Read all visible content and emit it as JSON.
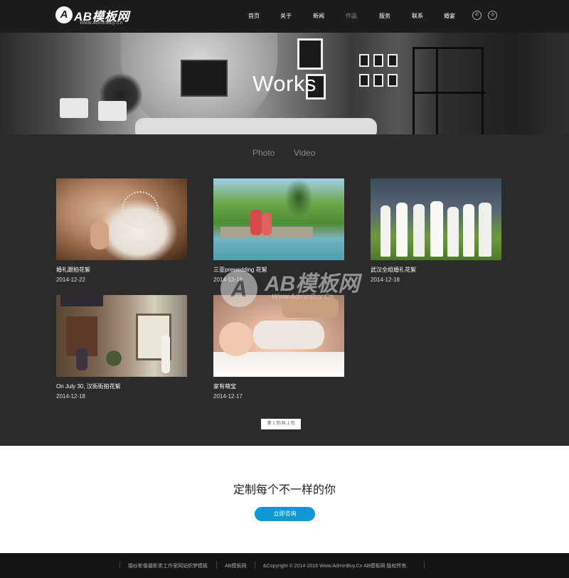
{
  "header": {
    "logo_mark": "A",
    "logo_text": "AB模板网",
    "logo_sub": "Www.AdminBuy.Cn",
    "nav": [
      "首页",
      "关于",
      "新闻",
      "作品",
      "服务",
      "联系",
      "婚宴"
    ],
    "active_nav": "作品",
    "icons": {
      "phone": "phone-icon",
      "wechat": "wechat-icon"
    }
  },
  "banner": {
    "title": "Works"
  },
  "tabs": [
    "Photo",
    "Video"
  ],
  "works": [
    {
      "title": "婚礼跟拍花絮",
      "date": "2014-12-22"
    },
    {
      "title": "三亚prewedding 花絮",
      "date": "2014-12-18"
    },
    {
      "title": "武汉全组婚礼花絮",
      "date": "2014-12-18"
    },
    {
      "title": "On July 30, 汉街街拍花絮",
      "date": "2014-12-18"
    },
    {
      "title": "家有萌宝",
      "date": "2014-12-17"
    }
  ],
  "watermark": {
    "mark": "A",
    "text": "AB模板网",
    "sub": "Www.AdminBuy.Cn"
  },
  "pager": {
    "label": "第 1 页/共 1 页"
  },
  "cta": {
    "title": "定制每个不一样的你",
    "button": "立即咨询"
  },
  "footer": {
    "items": [
      "婚纱影像摄影类工作室网站织梦模板",
      "AB模板网",
      "&Copyright © 2014-2016 Www.AdminBuy.Cn AB模板网 版权所有."
    ]
  },
  "colors": {
    "accent": "#0e98d6",
    "body_bg": "#2b2b2b",
    "header_bg": "#1c1c1c",
    "footer_bg": "#141414"
  }
}
